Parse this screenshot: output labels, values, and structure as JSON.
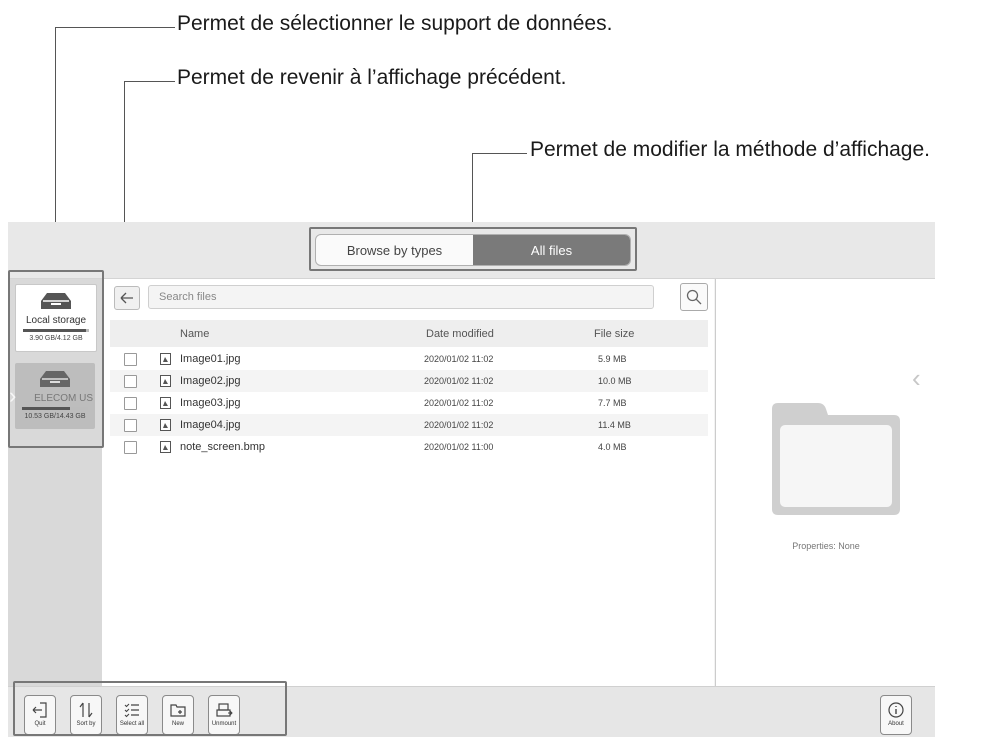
{
  "callouts": {
    "storage": "Permet de sélectionner le support de données.",
    "back": "Permet de revenir à l’affichage précédent.",
    "view_mode": "Permet de modifier la méthode d’affichage."
  },
  "view_toggle": {
    "browse_by_types": "Browse by types",
    "all_files": "All files",
    "active": "All files"
  },
  "sidebar": {
    "local": {
      "name": "Local storage",
      "size": "3.90 GB/4.12 GB",
      "used_fraction": 0.95
    },
    "usb": {
      "name": "ELECOM US",
      "size": "10.53 GB/14.43 GB",
      "used_fraction": 0.73
    }
  },
  "search": {
    "placeholder": "Search files"
  },
  "table": {
    "headers": {
      "name": "Name",
      "date": "Date modified",
      "size": "File size"
    },
    "rows": [
      {
        "name": "Image01.jpg",
        "date": "2020/01/02 11:02",
        "size": "5.9 MB"
      },
      {
        "name": "Image02.jpg",
        "date": "2020/01/02 11:02",
        "size": "10.0 MB"
      },
      {
        "name": "Image03.jpg",
        "date": "2020/01/02 11:02",
        "size": "7.7 MB"
      },
      {
        "name": "Image04.jpg",
        "date": "2020/01/02 11:02",
        "size": "11.4 MB"
      },
      {
        "name": "note_screen.bmp",
        "date": "2020/01/02 11:00",
        "size": "4.0 MB"
      }
    ]
  },
  "properties": {
    "label": "Properties: None"
  },
  "toolbar": {
    "quit": "Quit",
    "sort_by": "Sort by",
    "select_all": "Select all",
    "new": "New",
    "unmount": "Unmount",
    "about": "About"
  },
  "icons": [
    "back-icon",
    "search-icon",
    "drive-icon",
    "folder-icon",
    "image-file-icon",
    "quit-icon",
    "sort-icon",
    "select-all-icon",
    "new-folder-icon",
    "unmount-icon",
    "info-icon",
    "chevron-left-icon",
    "chevron-right-icon"
  ]
}
